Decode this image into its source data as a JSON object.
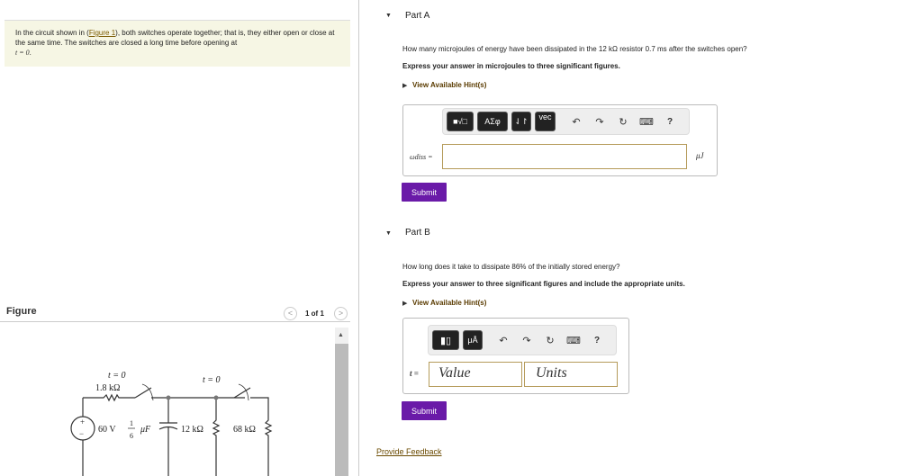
{
  "problem": {
    "text_before": "In the circuit shown in (",
    "figure_link": "Figure 1",
    "text_after": "), both switches operate together; that is, they either open or close at the same time. The switches are closed a long time before opening at ",
    "t_eq": "t = 0",
    "period": "."
  },
  "figure": {
    "label": "Figure",
    "pager": "1 of 1",
    "prev": "<",
    "next": ">",
    "circuit": {
      "switch1_label": "t = 0",
      "switch2_label": "t = 0",
      "r1": "1.8 kΩ",
      "source": "60 V",
      "cap_num": "1",
      "cap_den": "6",
      "cap_unit": "μF",
      "r2": "12 kΩ",
      "r3": "68 kΩ",
      "plus": "+",
      "minus": "−"
    }
  },
  "partA": {
    "title": "Part A",
    "question": "How many microjoules of energy have been dissipated in the 12 kΩ resistor 0.7 ms after the switches open?",
    "instruction": "Express your answer in microjoules to three significant figures.",
    "hint": "View Available Hint(s)",
    "toolbar": {
      "templates": "■√□",
      "greek": "ΑΣφ",
      "arrows": "⇃↾",
      "vec": "vec",
      "help": "?"
    },
    "var_label": "ωdiss =",
    "value": "",
    "unit": "μJ",
    "submit": "Submit"
  },
  "partB": {
    "title": "Part B",
    "question": "How long does it take to dissipate 86% of the initially stored energy?",
    "instruction": "Express your answer to three significant figures and include the appropriate units.",
    "hint": "View Available Hint(s)",
    "toolbar": {
      "units": "μÅ",
      "help": "?"
    },
    "var_label": "t =",
    "value_placeholder": "Value",
    "units_placeholder": "Units",
    "submit": "Submit"
  },
  "feedback": "Provide Feedback"
}
